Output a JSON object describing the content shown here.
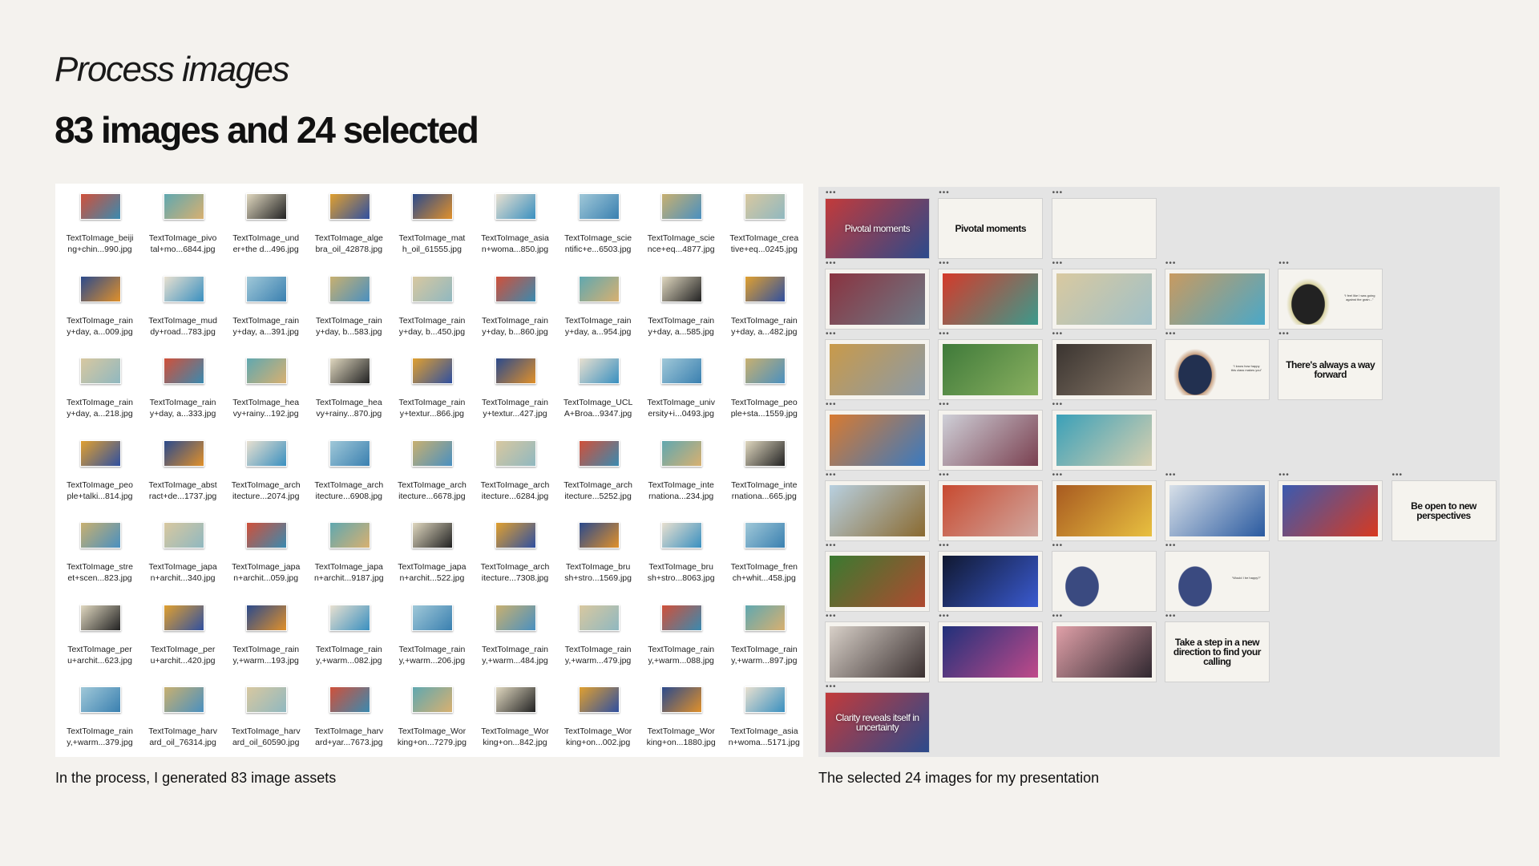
{
  "header": {
    "kicker": "Process images",
    "title": "83 images and 24 selected"
  },
  "left_panel": {
    "caption": "In the process, I generated 83 image assets",
    "files": [
      "TextToImage_beiji\nng+chin...990.jpg",
      "TextToImage_pivo\ntal+mo...6844.jpg",
      "TextToImage_und\ner+the d...496.jpg",
      "TextToImage_alge\nbra_oil_42878.jpg",
      "TextToImage_mat\nh_oil_61555.jpg",
      "TextToImage_asia\nn+woma...850.jpg",
      "TextToImage_scie\nntific+e...6503.jpg",
      "TextToImage_scie\nnce+eq...4877.jpg",
      "TextToImage_crea\ntive+eq...0245.jpg",
      "TextToImage_rain\ny+day, a...009.jpg",
      "TextToImage_mud\ndy+road...783.jpg",
      "TextToImage_rain\ny+day, a...391.jpg",
      "TextToImage_rain\ny+day, b...583.jpg",
      "TextToImage_rain\ny+day, b...450.jpg",
      "TextToImage_rain\ny+day, b...860.jpg",
      "TextToImage_rain\ny+day, a...954.jpg",
      "TextToImage_rain\ny+day, a...585.jpg",
      "TextToImage_rain\ny+day, a...482.jpg",
      "TextToImage_rain\ny+day, a...218.jpg",
      "TextToImage_rain\ny+day, a...333.jpg",
      "TextToImage_hea\nvy+rainy...192.jpg",
      "TextToImage_hea\nvy+rainy...870.jpg",
      "TextToImage_rain\ny+textur...866.jpg",
      "TextToImage_rain\ny+textur...427.jpg",
      "TextToImage_UCL\nA+Broa...9347.jpg",
      "TextToImage_univ\nersity+i...0493.jpg",
      "TextToImage_peo\nple+sta...1559.jpg",
      "TextToImage_peo\nple+talki...814.jpg",
      "TextToImage_abst\nract+de...1737.jpg",
      "TextToImage_arch\nitecture...2074.jpg",
      "TextToImage_arch\nitecture...6908.jpg",
      "TextToImage_arch\nitecture...6678.jpg",
      "TextToImage_arch\nitecture...6284.jpg",
      "TextToImage_arch\nitecture...5252.jpg",
      "TextToImage_inte\nrnationa...234.jpg",
      "TextToImage_inte\nrnationa...665.jpg",
      "TextToImage_stre\net+scen...823.jpg",
      "TextToImage_japa\nn+archit...340.jpg",
      "TextToImage_japa\nn+archit...059.jpg",
      "TextToImage_japa\nn+archit...9187.jpg",
      "TextToImage_japa\nn+archit...522.jpg",
      "TextToImage_arch\nitecture...7308.jpg",
      "TextToImage_bru\nsh+stro...1569.jpg",
      "TextToImage_bru\nsh+stro...8063.jpg",
      "TextToImage_fren\nch+whit...458.jpg",
      "TextToImage_per\nu+archit...623.jpg",
      "TextToImage_per\nu+archit...420.jpg",
      "TextToImage_rain\ny,+warm...193.jpg",
      "TextToImage_rain\ny,+warm...082.jpg",
      "TextToImage_rain\ny,+warm...206.jpg",
      "TextToImage_rain\ny,+warm...484.jpg",
      "TextToImage_rain\ny,+warm...479.jpg",
      "TextToImage_rain\ny,+warm...088.jpg",
      "TextToImage_rain\ny,+warm...897.jpg",
      "TextToImage_rain\ny,+warm...379.jpg",
      "TextToImage_harv\nard_oil_76314.jpg",
      "TextToImage_harv\nard_oil_60590.jpg",
      "TextToImage_harv\nard+yar...7673.jpg",
      "TextToImage_Wor\nking+on...7279.jpg",
      "TextToImage_Wor\nking+on...842.jpg",
      "TextToImage_Wor\nking+on...002.jpg",
      "TextToImage_Wor\nking+on...1880.jpg",
      "TextToImage_asia\nn+woma...5171.jpg"
    ]
  },
  "right_panel": {
    "caption": "The selected 24 images for my presentation",
    "rows": [
      [
        {
          "type": "full",
          "title": "Pivotal moments",
          "colors": [
            "#c33a3a",
            "#2b4a8c"
          ]
        },
        {
          "type": "text",
          "title": "Pivotal moments"
        },
        {
          "type": "blank"
        }
      ],
      [
        {
          "type": "image",
          "colors": [
            "#8a3340",
            "#6d7a86"
          ]
        },
        {
          "type": "image",
          "colors": [
            "#d43a2a",
            "#3c9a8c"
          ]
        },
        {
          "type": "image",
          "colors": [
            "#d9c9a0",
            "#9fc0c8"
          ]
        },
        {
          "type": "image",
          "colors": [
            "#c89a60",
            "#4aa8c8"
          ]
        },
        {
          "type": "quote",
          "quote": "“I feel like I was going against the grain...”",
          "colors": [
            "#222",
            "#d8d2a0"
          ]
        }
      ],
      [
        {
          "type": "image",
          "colors": [
            "#c99a4a",
            "#8a9aa8"
          ]
        },
        {
          "type": "image",
          "colors": [
            "#3f7a3a",
            "#8ab060"
          ]
        },
        {
          "type": "image",
          "colors": [
            "#3a3430",
            "#8a7a6a"
          ]
        },
        {
          "type": "quote",
          "quote": "“I know how happy this class makes you”",
          "colors": [
            "#223050",
            "#c8a080"
          ]
        },
        {
          "type": "text",
          "title": "There's always a way forward"
        }
      ],
      [
        {
          "type": "image",
          "colors": [
            "#d87a30",
            "#3a7ac0"
          ]
        },
        {
          "type": "image",
          "colors": [
            "#cfd0d8",
            "#7a4050"
          ]
        },
        {
          "type": "image",
          "colors": [
            "#3aa0b8",
            "#d8d0b0"
          ]
        }
      ],
      [
        {
          "type": "image",
          "colors": [
            "#b8d0e0",
            "#8a6a30"
          ]
        },
        {
          "type": "image",
          "colors": [
            "#c84a30",
            "#d0a8a0"
          ]
        },
        {
          "type": "image",
          "colors": [
            "#a85a20",
            "#e8c040"
          ]
        },
        {
          "type": "image",
          "colors": [
            "#d8e0e8",
            "#2a5aa0"
          ]
        },
        {
          "type": "image",
          "colors": [
            "#3a5ab0",
            "#d83a20"
          ]
        },
        {
          "type": "text",
          "title": "Be open to new perspectives"
        }
      ],
      [
        {
          "type": "image",
          "colors": [
            "#3a7a30",
            "#b04a30"
          ]
        },
        {
          "type": "image",
          "colors": [
            "#101830",
            "#3a5ad0"
          ]
        },
        {
          "type": "quote",
          "quote": "",
          "colors": [
            "#3a4a80",
            "#f5f3ee"
          ]
        },
        {
          "type": "quote",
          "quote": "“Would I be happy?”",
          "colors": [
            "#3a4a80",
            "#f5f3ee"
          ]
        }
      ],
      [
        {
          "type": "image",
          "colors": [
            "#d8d0c8",
            "#3a3030"
          ]
        },
        {
          "type": "image",
          "colors": [
            "#20307a",
            "#c04a8a"
          ]
        },
        {
          "type": "image",
          "colors": [
            "#e0a0a8",
            "#302830"
          ]
        },
        {
          "type": "text",
          "title": "Take a step in a new direction to find your calling"
        }
      ],
      [
        {
          "type": "full",
          "title": "Clarity reveals itself in uncertainty",
          "colors": [
            "#c33a3a",
            "#2b4a8c"
          ]
        }
      ]
    ]
  },
  "colors": {
    "background": "#f4f2ee",
    "left_panel": "#ffffff",
    "right_panel": "#e4e4e4"
  }
}
